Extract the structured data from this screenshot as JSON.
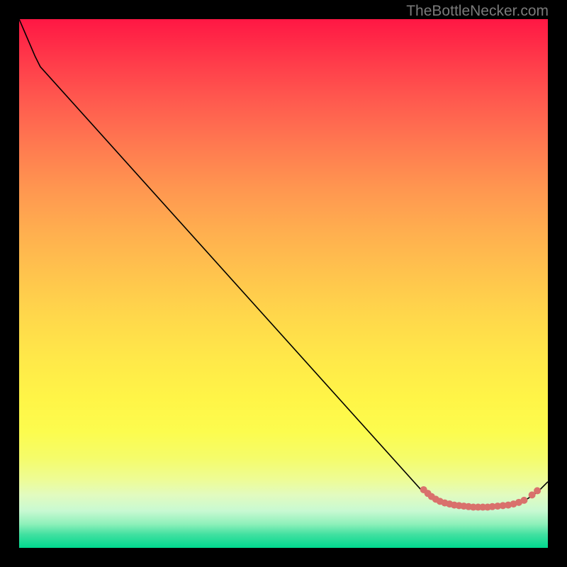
{
  "watermark": "TheBottleNecker.com",
  "chart_data": {
    "type": "line",
    "title": "",
    "xlabel": "",
    "ylabel": "",
    "xlim": [
      0,
      100
    ],
    "ylim": [
      0,
      100
    ],
    "gradient_meaning": "red high to green low (bottleneck severity)",
    "line": {
      "x": [
        0,
        3,
        4,
        76,
        78,
        79,
        80,
        81,
        82,
        83,
        84,
        85,
        86,
        87,
        88,
        89,
        90,
        91,
        92,
        93,
        94,
        95,
        96,
        98,
        100
      ],
      "y": [
        100,
        93,
        91,
        11,
        9.5,
        9.0,
        8.5,
        8.3,
        8.1,
        8.0,
        7.9,
        7.8,
        7.7,
        7.7,
        7.7,
        7.7,
        7.8,
        7.9,
        8.0,
        8.1,
        8.3,
        8.7,
        9.2,
        10.5,
        12.5
      ]
    },
    "markers": {
      "x": [
        76.5,
        77.3,
        78.0,
        78.8,
        79.6,
        80.5,
        81.4,
        82.3,
        83.2,
        84.1,
        85.0,
        85.9,
        86.8,
        87.7,
        88.6,
        89.5,
        90.5,
        91.5,
        92.5,
        93.5,
        94.5,
        95.5,
        97.0,
        98.0
      ],
      "y": [
        11.0,
        10.3,
        9.7,
        9.2,
        8.8,
        8.5,
        8.3,
        8.1,
        8.0,
        7.9,
        7.8,
        7.7,
        7.7,
        7.7,
        7.7,
        7.8,
        7.9,
        8.0,
        8.1,
        8.3,
        8.6,
        9.0,
        10.0,
        10.8
      ],
      "color": "#d9716c",
      "radius": 5
    }
  }
}
